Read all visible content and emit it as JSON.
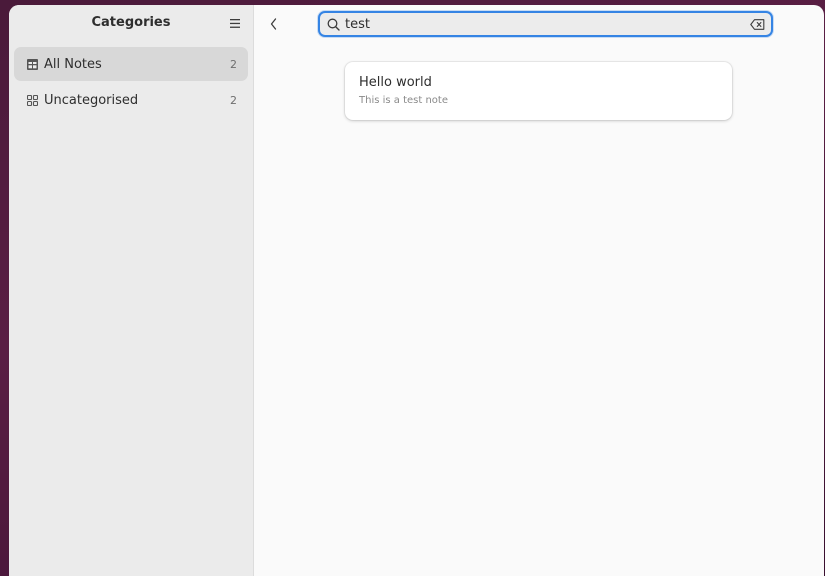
{
  "sidebar": {
    "title": "Categories",
    "items": [
      {
        "label": "All Notes",
        "count": "2",
        "icon": "all-notes-icon",
        "selected": true
      },
      {
        "label": "Uncategorised",
        "count": "2",
        "icon": "grid-icon",
        "selected": false
      }
    ]
  },
  "search": {
    "value": "test",
    "placeholder": ""
  },
  "notes": [
    {
      "title": "Hello world",
      "preview": "This is a test note"
    }
  ],
  "colors": {
    "accent": "#3584e4",
    "sidebar_bg": "#ebebeb",
    "main_bg": "#fafafa"
  }
}
